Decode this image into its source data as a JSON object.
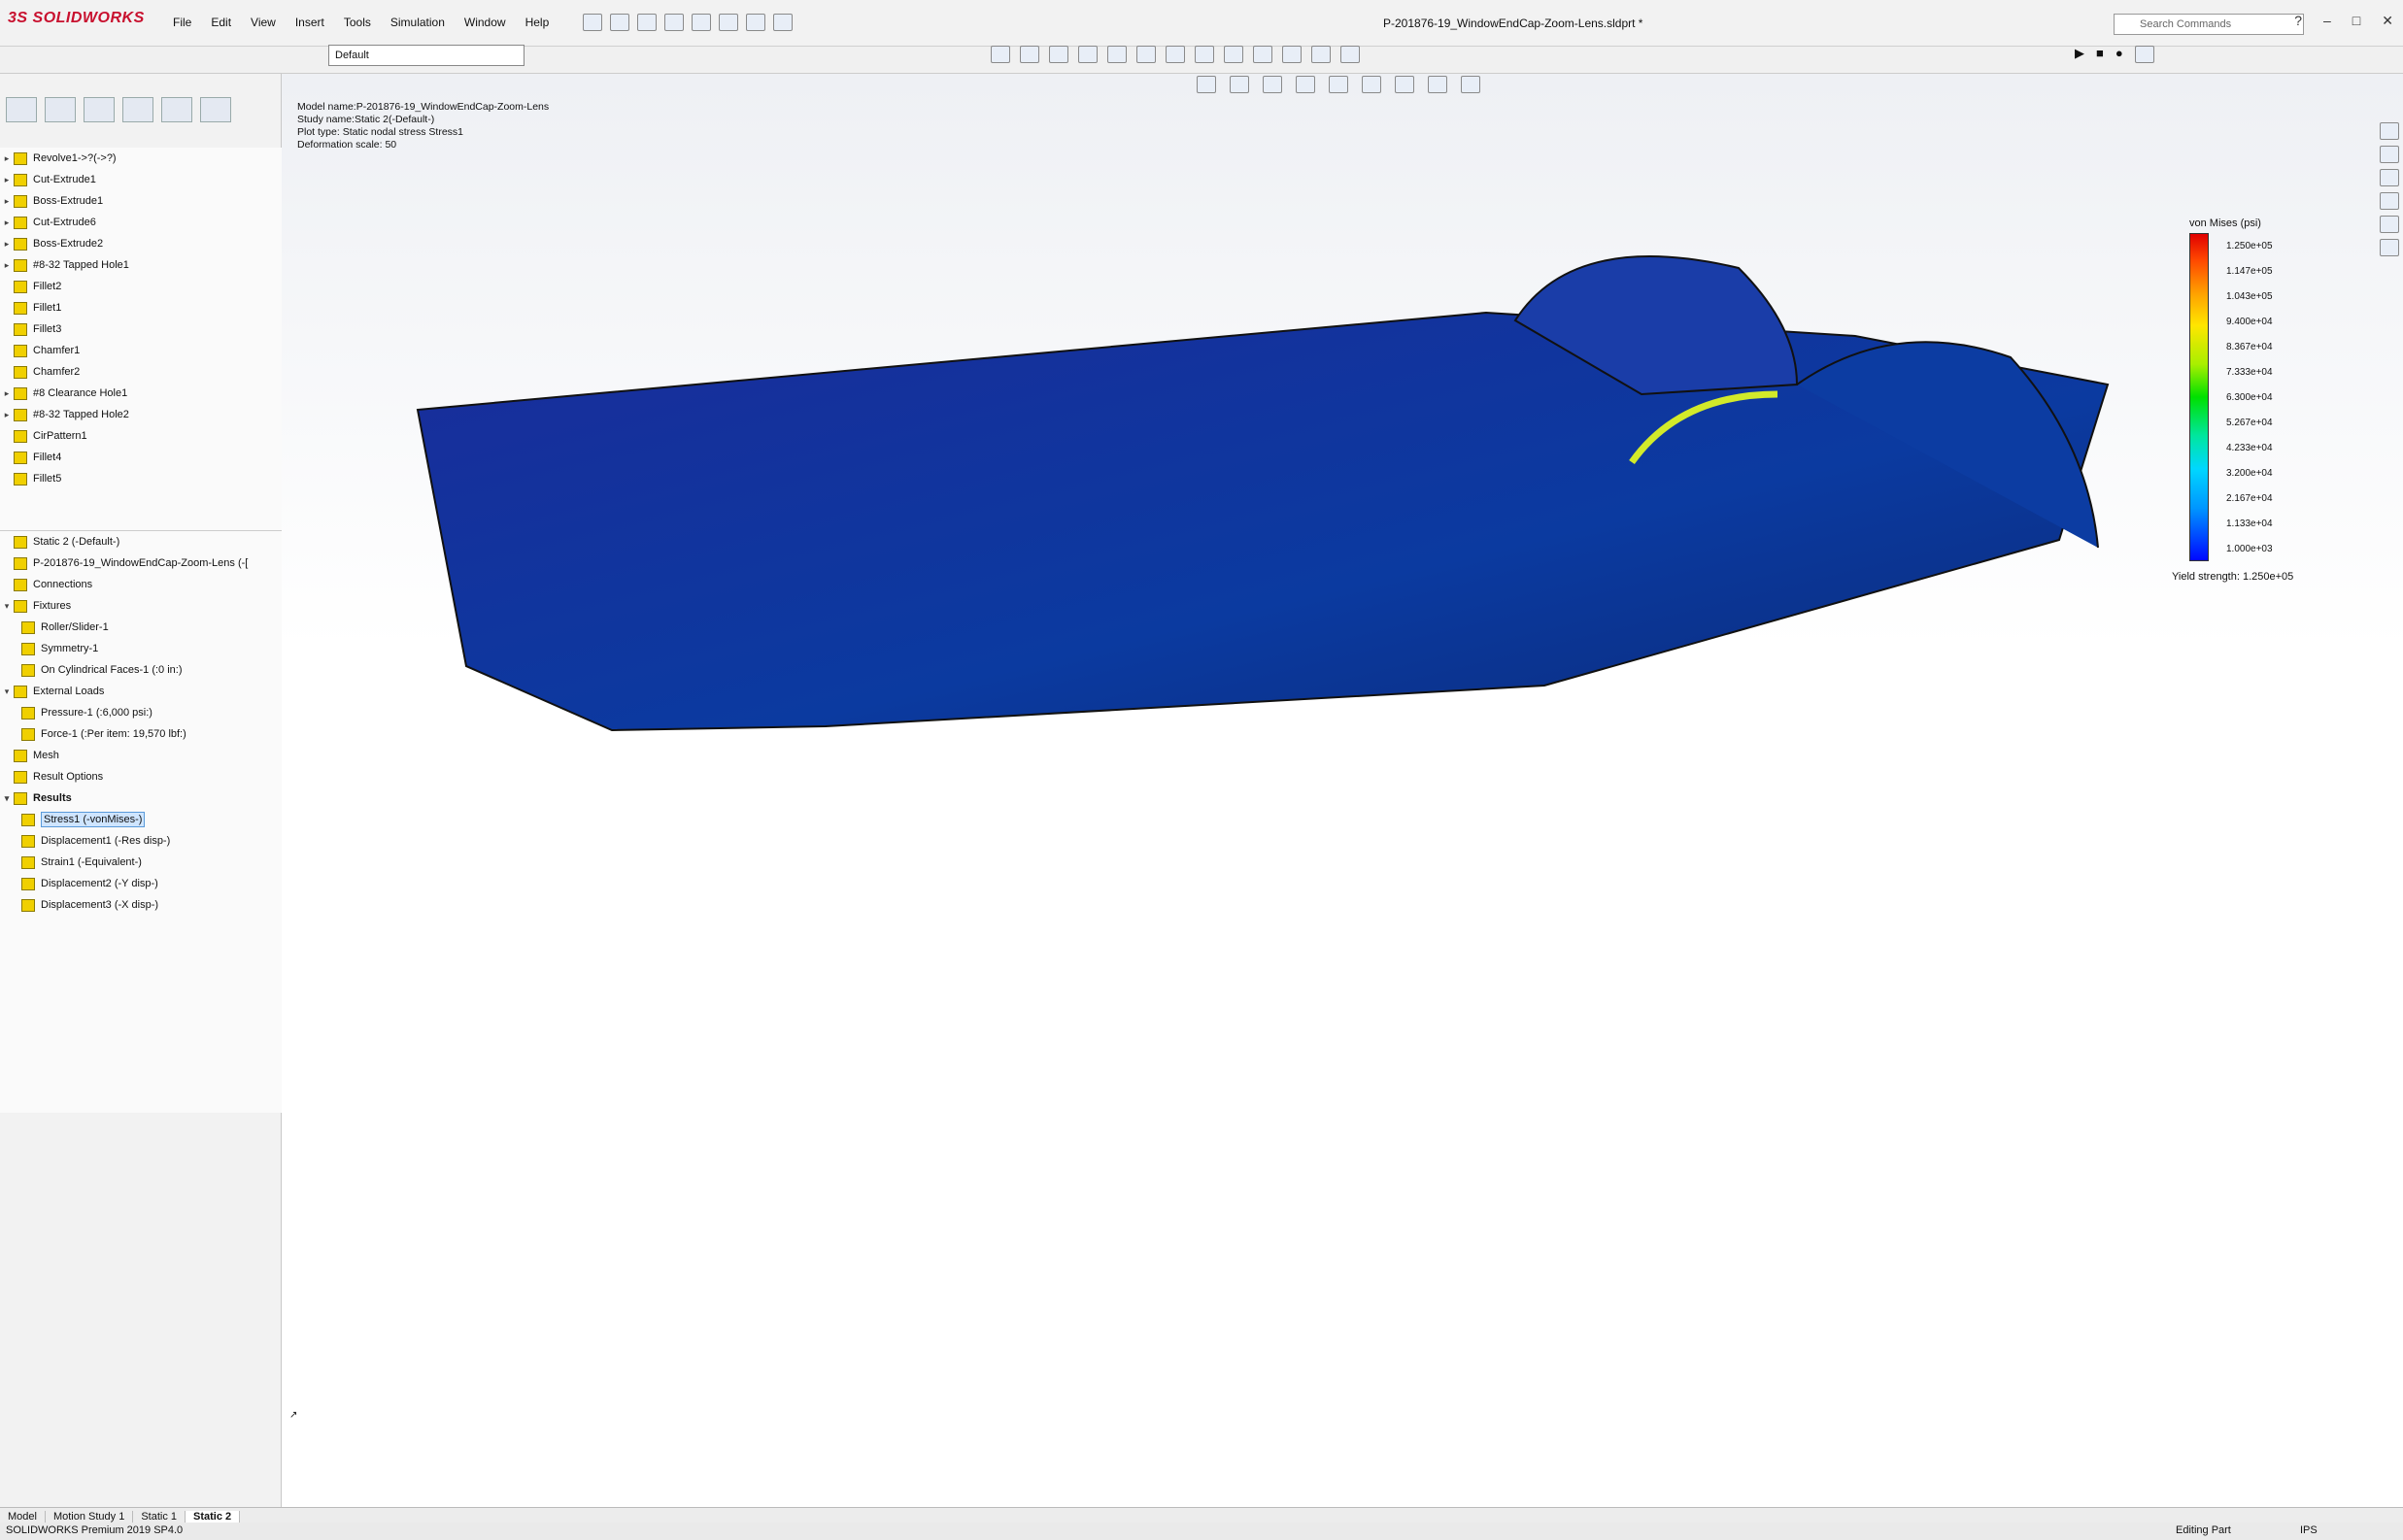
{
  "app": {
    "logo": "3S SOLIDWORKS",
    "title": "P-201876-19_WindowEndCap-Zoom-Lens.sldprt *",
    "search_placeholder": "Search Commands"
  },
  "menus": [
    "File",
    "Edit",
    "View",
    "Insert",
    "Tools",
    "Simulation",
    "Window",
    "Help"
  ],
  "config": {
    "selected": "Default"
  },
  "tree_top": [
    "Revolve1->?(->?)",
    "Cut-Extrude1",
    "Boss-Extrude1",
    "Cut-Extrude6",
    "Boss-Extrude2",
    "#8-32 Tapped Hole1",
    "Fillet2",
    "Fillet1",
    "Fillet3",
    "Chamfer1",
    "Chamfer2",
    "#8 Clearance Hole1",
    "#8-32 Tapped Hole2",
    "CirPattern1",
    "Fillet4",
    "Fillet5"
  ],
  "tree_sim": {
    "study": "Static 2 (-Default-)",
    "part": "P-201876-19_WindowEndCap-Zoom-Lens (-[",
    "connections": "Connections",
    "fixtures": "Fixtures",
    "fix1": "Roller/Slider-1",
    "fix2": "Symmetry-1",
    "fix3": "On Cylindrical Faces-1 (:0 in:)",
    "loads": "External Loads",
    "load1": "Pressure-1 (:6,000 psi:)",
    "load2": "Force-1 (:Per item: 19,570 lbf:)",
    "mesh": "Mesh",
    "resopt": "Result Options",
    "results": "Results",
    "res1": "Stress1 (-vonMises-)",
    "res2": "Displacement1 (-Res disp-)",
    "res3": "Strain1 (-Equivalent-)",
    "res4": "Displacement2 (-Y disp-)",
    "res5": "Displacement3 (-X disp-)"
  },
  "info": {
    "l1": "Model name:P-201876-19_WindowEndCap-Zoom-Lens",
    "l2": "Study name:Static 2(-Default-)",
    "l3": "Plot type: Static nodal stress Stress1",
    "l4": "Deformation scale: 50"
  },
  "legend": {
    "title": "von Mises (psi)",
    "ticks": [
      "1.250e+05",
      "1.147e+05",
      "1.043e+05",
      "9.400e+04",
      "8.367e+04",
      "7.333e+04",
      "6.300e+04",
      "5.267e+04",
      "4.233e+04",
      "3.200e+04",
      "2.167e+04",
      "1.133e+04",
      "1.000e+03"
    ],
    "yield": "Yield strength: 1.250e+05"
  },
  "tabs": {
    "model": "Model",
    "motion": "Motion Study 1",
    "static1": "Static 1",
    "static2": "Static 2"
  },
  "status": {
    "left": "SOLIDWORKS Premium 2019 SP4.0",
    "editing": "Editing Part",
    "units": "IPS"
  }
}
